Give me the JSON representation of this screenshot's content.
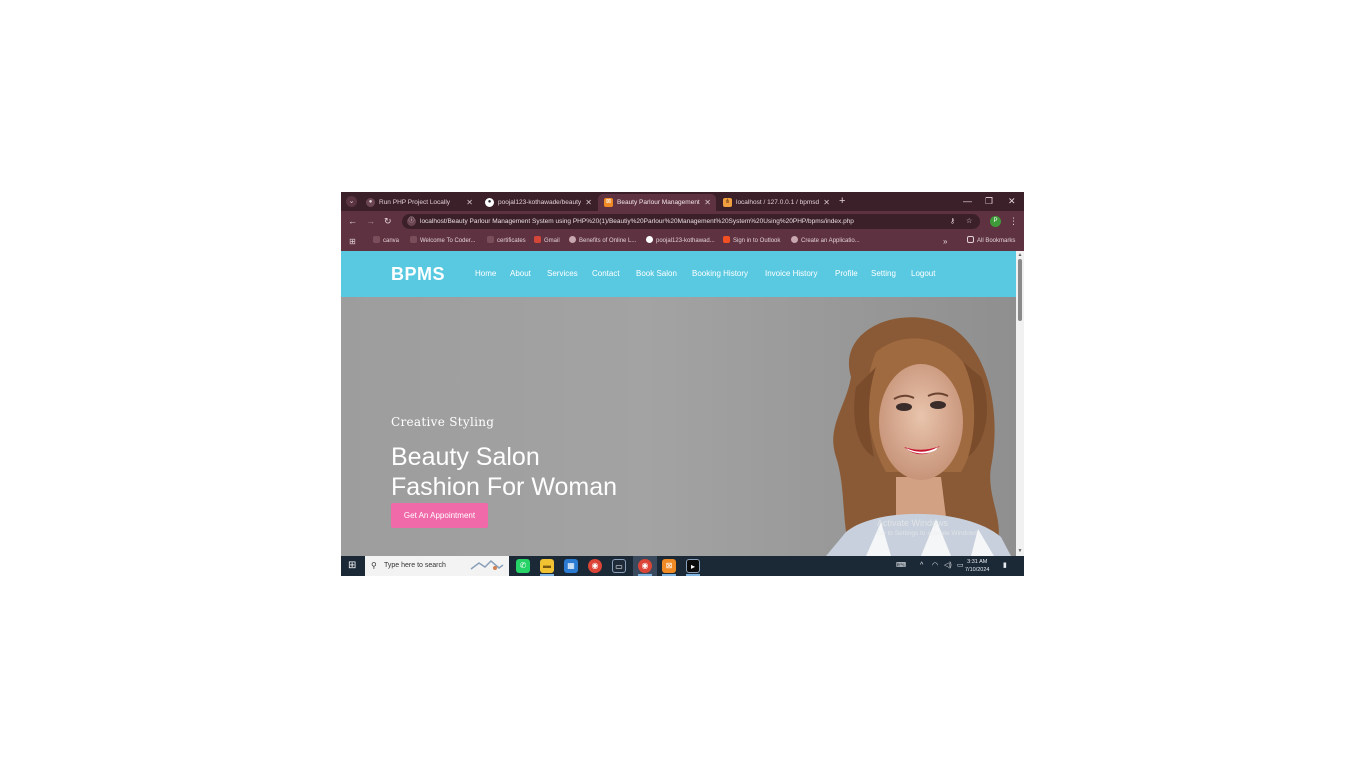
{
  "browser": {
    "tabs": [
      {
        "title": "Run PHP Project Locally",
        "active": false
      },
      {
        "title": "poojal123-kothawade/beauty-...",
        "active": false
      },
      {
        "title": "Beauty Parlour Management Sy",
        "active": true
      },
      {
        "title": "localhost / 127.0.0.1 / bpmsdb",
        "active": false
      }
    ],
    "url": "localhost/Beauty Parlour Management System using PHP%20(1)/Beautiy%20Parlour%20Management%20System%20Using%20PHP/bpms/index.php",
    "profile_initial": "P",
    "bookmarks": [
      "canva",
      "Welcome To Coder...",
      "certificates",
      "Gmail",
      "Benefits of Online L...",
      "poojal123-kothawad...",
      "Sign in to Outlook",
      "Create an Applicatio..."
    ],
    "all_bookmarks_label": "All Bookmarks",
    "icons": {
      "back": "arrow-left-icon",
      "forward": "arrow-right-icon",
      "reload": "reload-icon",
      "star": "star-icon",
      "menu": "kebab-menu-icon",
      "new_tab": "plus-icon"
    }
  },
  "site": {
    "logo": "BPMS",
    "nav": [
      "Home",
      "About",
      "Services",
      "Contact",
      "Book Salon",
      "Booking History",
      "Invoice History",
      "Profile",
      "Setting",
      "Logout"
    ],
    "hero": {
      "kicker": "Creative Styling",
      "headline_line1": "Beauty Salon",
      "headline_line2": "Fashion For Woman",
      "cta": "Get An Appointment"
    },
    "colors": {
      "header": "#59c9e1",
      "cta": "#f06aaa",
      "browser_frame": "#3b2029",
      "taskbar": "#1b2836"
    }
  },
  "watermark": {
    "title": "Activate Windows",
    "subtitle": "Go to Settings to activate Windows."
  },
  "taskbar": {
    "search_placeholder": "Type here to search",
    "time": "3:31 AM",
    "date": "7/10/2024"
  }
}
